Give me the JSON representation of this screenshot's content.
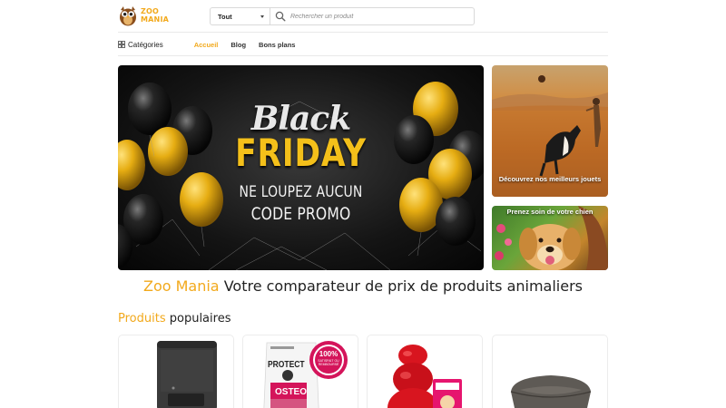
{
  "header": {
    "logo_line1": "ZOO",
    "logo_line2": "MANIA",
    "search_category": "Tout",
    "search_placeholder": "Rechercher un produit"
  },
  "nav": {
    "categories_label": "Catégories",
    "links": [
      "Accueil",
      "Blog",
      "Bons plans"
    ],
    "active_link": "Accueil"
  },
  "banner": {
    "line_black": "Black",
    "line_friday": "FRIDAY",
    "line_1": "NE LOUPEZ AUCUN",
    "line_2": "CODE PROMO"
  },
  "side_cards": [
    {
      "caption": "Découvrez nos meilleurs jouets"
    },
    {
      "caption": "Prenez soin de votre chien"
    }
  ],
  "headline": {
    "brand": "Zoo Mania",
    "rest": "Votre comparateur de prix de produits animaliers"
  },
  "products_section": {
    "title_accent": "Produits",
    "title_rest": "populaires"
  },
  "products": [
    {
      "icon": "automatic-feeder-image"
    },
    {
      "icon": "osteo-protect-food-bag-image",
      "badge": "100%",
      "badge_sub": "SATISFAIT OU REMBOURSÉ",
      "bag_title": "PROTECT",
      "bag_label": "OSTEO"
    },
    {
      "icon": "kong-classic-toy-image"
    },
    {
      "icon": "pet-bed-image"
    }
  ],
  "colors": {
    "accent": "#f2a91c",
    "text": "#222222",
    "border": "#e9e9e9"
  }
}
